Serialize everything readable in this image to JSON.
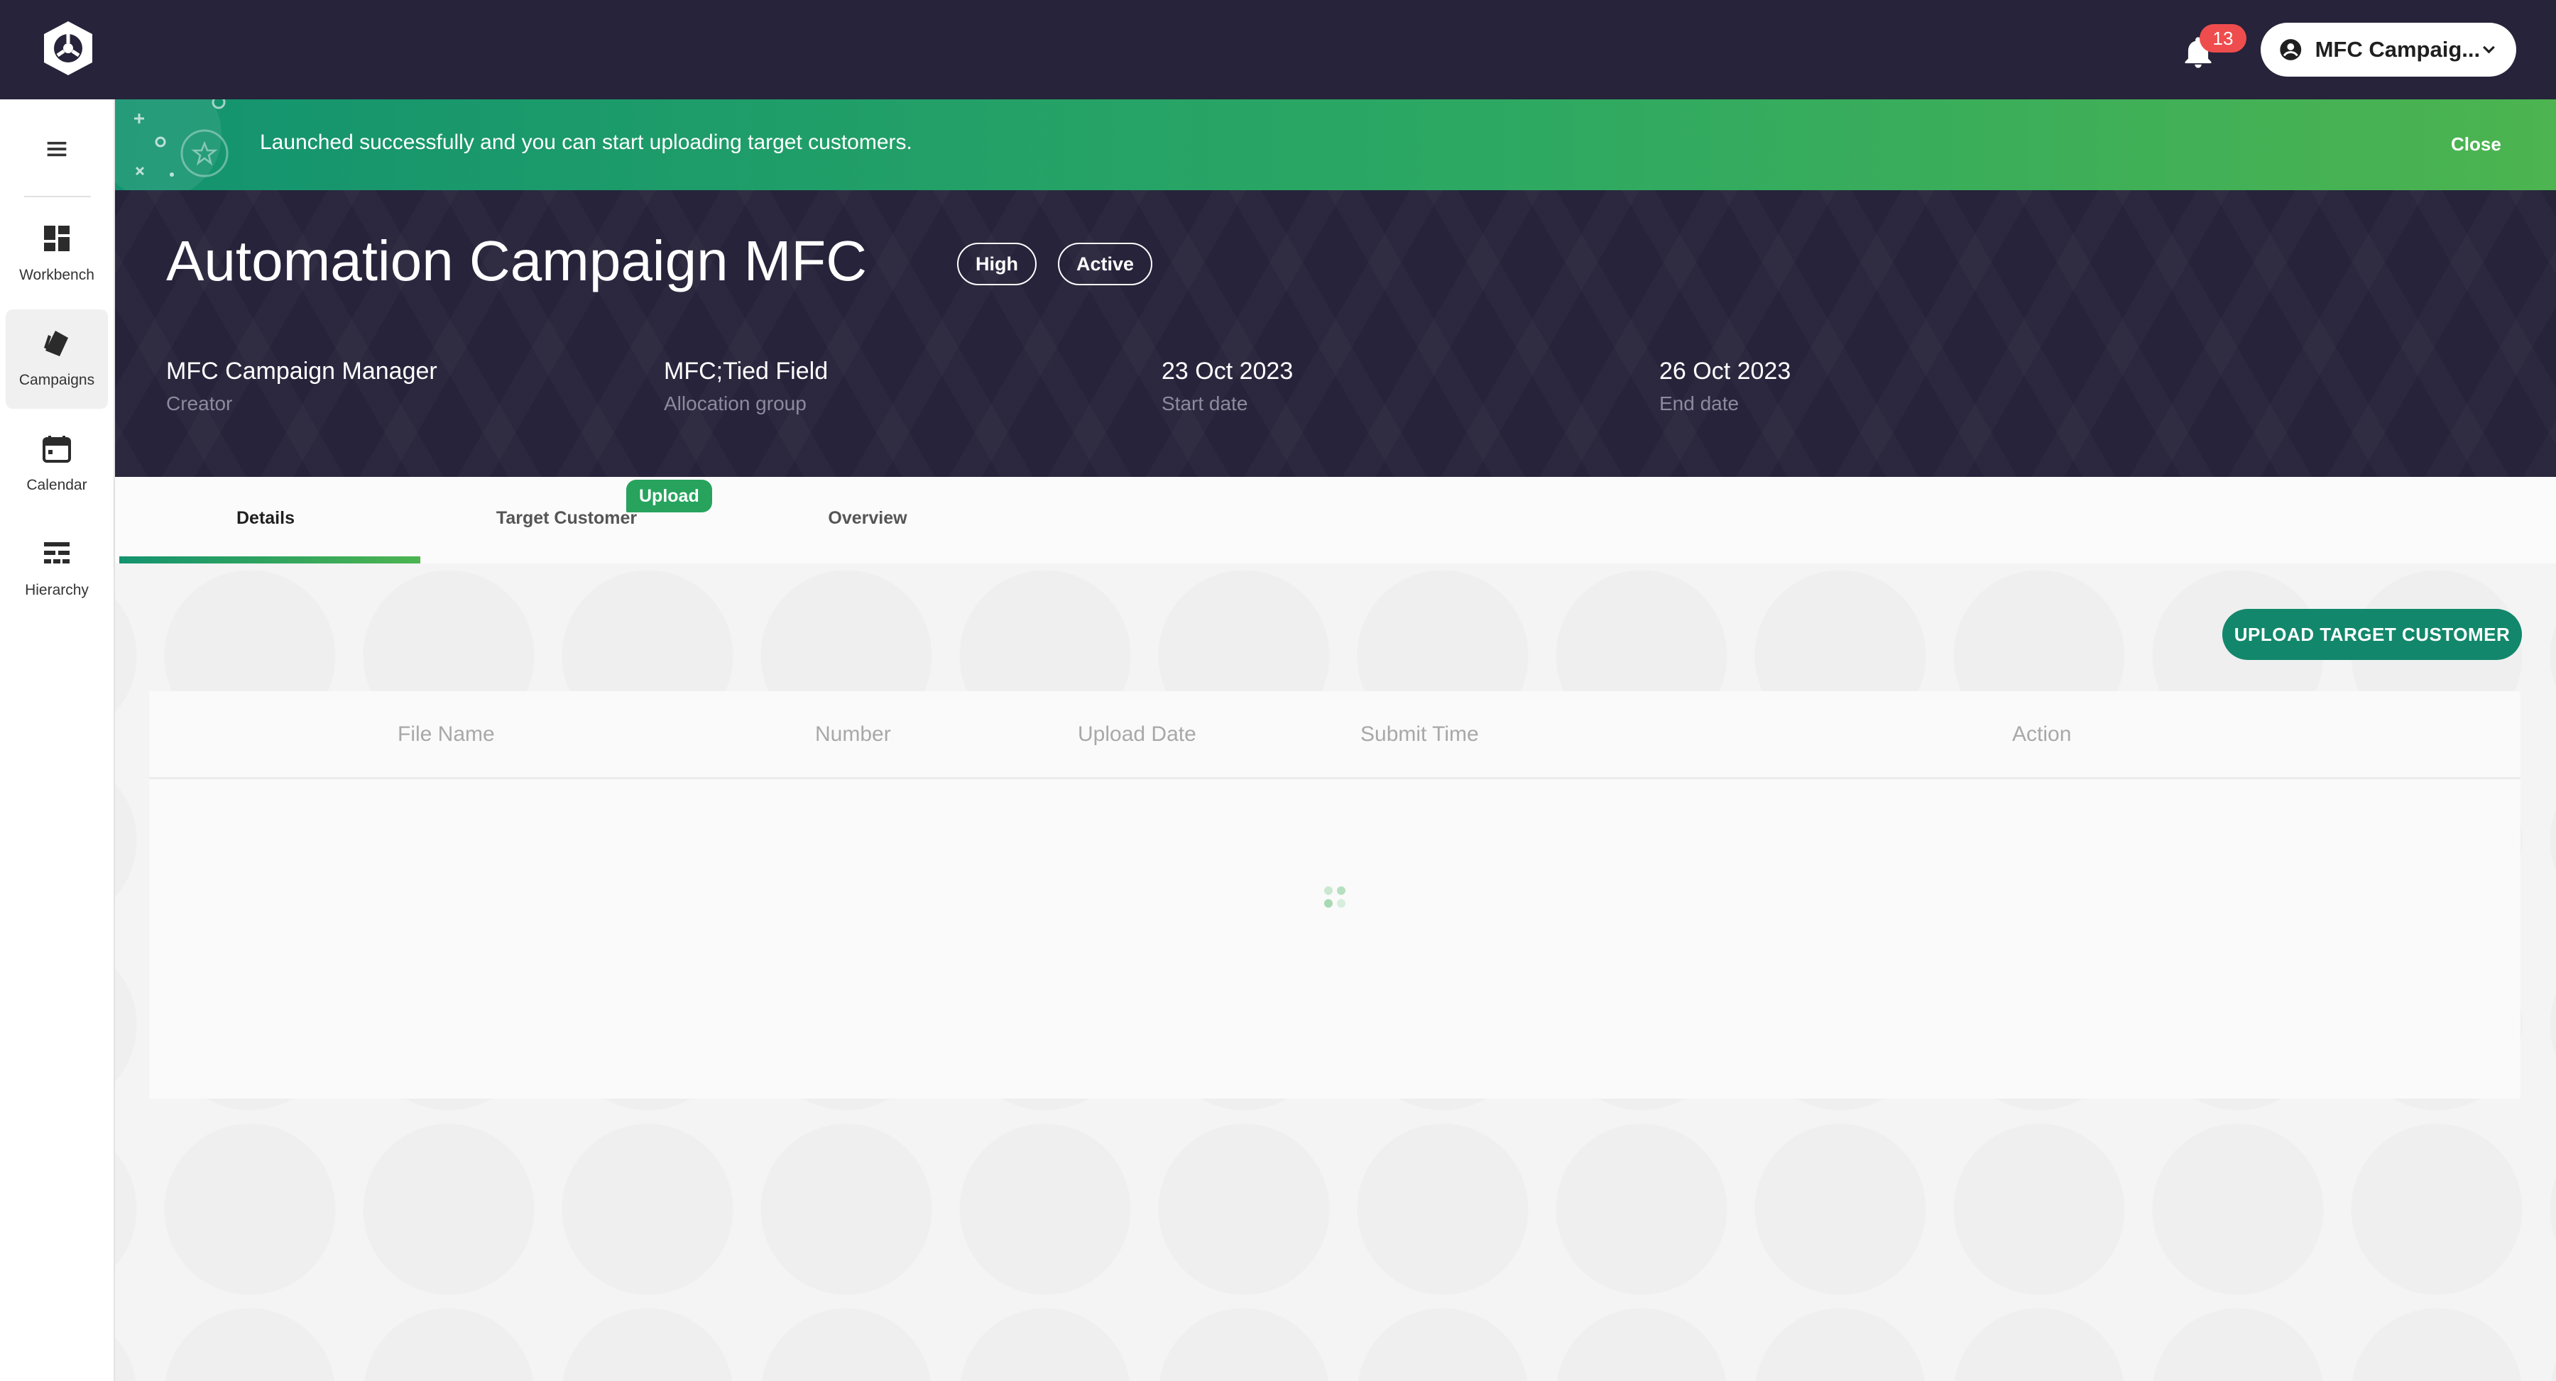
{
  "topbar": {
    "notifications_count": "13",
    "user_label": "MFC Campaig...",
    "icons": {
      "logo": "company-logo-icon",
      "bell": "bell-icon",
      "user": "user-circle-icon",
      "chevron": "chevron-down-icon"
    }
  },
  "sidebar": {
    "menu_icon": "hamburger-menu-icon",
    "items": [
      {
        "label": "Workbench",
        "icon": "dashboard-icon",
        "active": false
      },
      {
        "label": "Campaigns",
        "icon": "tag-icon",
        "active": true
      },
      {
        "label": "Calendar",
        "icon": "calendar-icon",
        "active": false
      },
      {
        "label": "Hierarchy",
        "icon": "hierarchy-icon",
        "active": false
      }
    ]
  },
  "banner": {
    "message": "Launched successfully and you can start uploading target customers.",
    "close_label": "Close"
  },
  "campaign": {
    "title": "Automation Campaign MFC",
    "priority": "High",
    "status": "Active",
    "meta": [
      {
        "value": "MFC Campaign Manager",
        "label": "Creator"
      },
      {
        "value": "MFC;Tied Field",
        "label": "Allocation group"
      },
      {
        "value": "23 Oct 2023",
        "label": "Start date"
      },
      {
        "value": "26 Oct 2023",
        "label": "End date"
      }
    ]
  },
  "tabs": {
    "items": [
      {
        "label": "Details",
        "active": true
      },
      {
        "label": "Target Customer",
        "active": false
      },
      {
        "label": "Overview",
        "active": false
      }
    ],
    "badge": "Upload"
  },
  "main": {
    "upload_button": "UPLOAD TARGET CUSTOMER",
    "table": {
      "columns": [
        "File Name",
        "Number",
        "Upload Date",
        "Submit Time",
        "Action"
      ],
      "rows": []
    }
  },
  "colors": {
    "header_bg": "#26233a",
    "accent_green": "#12876b",
    "banner_start": "#13936f",
    "banner_end": "#4cb450",
    "badge_red": "#ef4d4d"
  }
}
